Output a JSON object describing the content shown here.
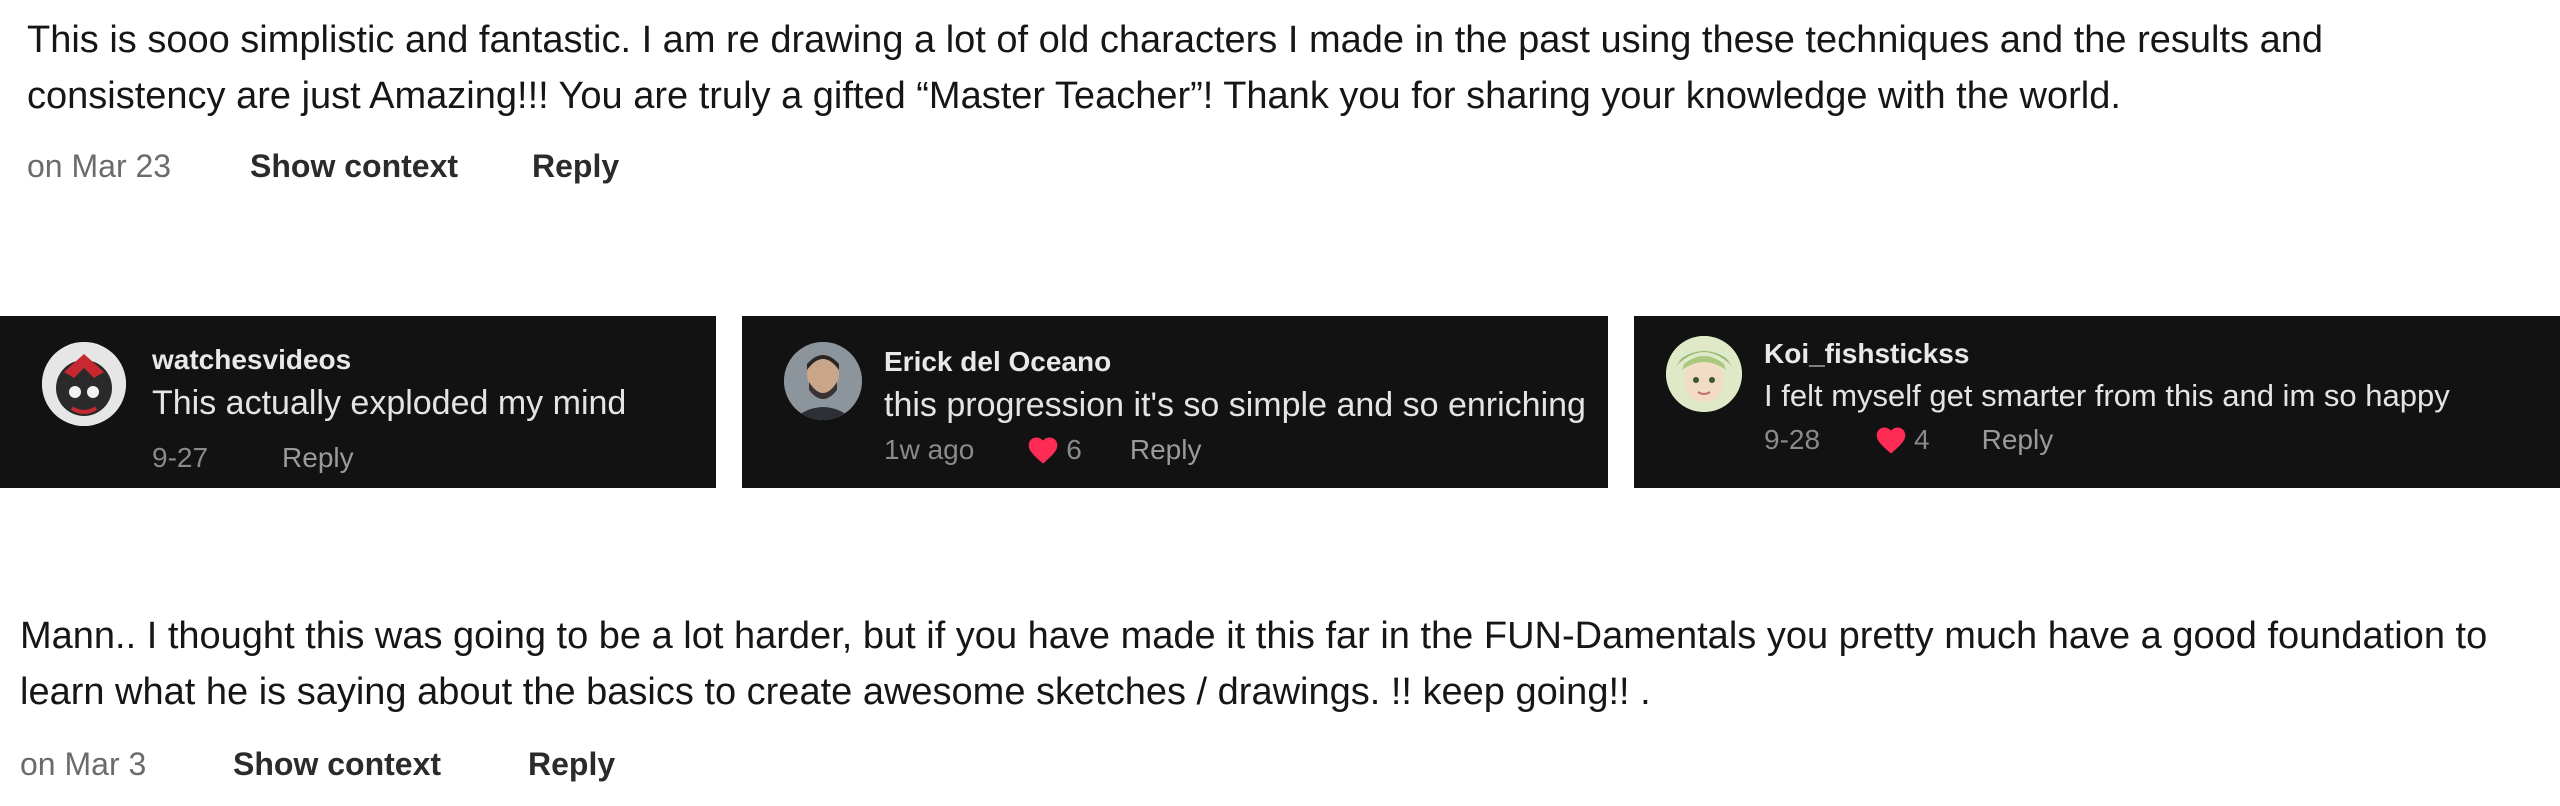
{
  "comments": [
    {
      "text": "This is sooo simplistic and fantastic. I am re drawing a lot of old characters I made in the past using these techniques and the results and consistency are just Amazing!!! You are truly a gifted “Master Teacher”! Thank you for sharing your knowledge with the world.",
      "date": "on Mar 23",
      "show_context": "Show context",
      "reply": "Reply"
    },
    {
      "text": "Mann.. I thought this was going to be a lot harder, but if you have made it this far in the FUN-Damentals you pretty much have a good foundation to learn what he is saying about the basics to create awesome sketches / drawings. !! keep going!! .",
      "date": "on Mar 3",
      "show_context": "Show context",
      "reply": "Reply"
    }
  ],
  "screenshots": [
    {
      "username": "watchesvideos",
      "text": "This actually exploded my mind",
      "date": "9-27",
      "likes": "",
      "reply": "Reply",
      "avatar_color": "#c8282f"
    },
    {
      "username": "Erick del Oceano",
      "text": "this progression it's so simple and so enriching",
      "date": "1w ago",
      "likes": "6",
      "reply": "Reply",
      "avatar_color": "#3c4650"
    },
    {
      "username": "Koi_fishstickss",
      "text": "I felt myself get smarter from this and im so happy",
      "date": "9-28",
      "likes": "4",
      "reply": "Reply",
      "avatar_color": "#8fb46a"
    }
  ],
  "colors": {
    "heart": "#fe2c55",
    "card_bg": "#121212"
  }
}
